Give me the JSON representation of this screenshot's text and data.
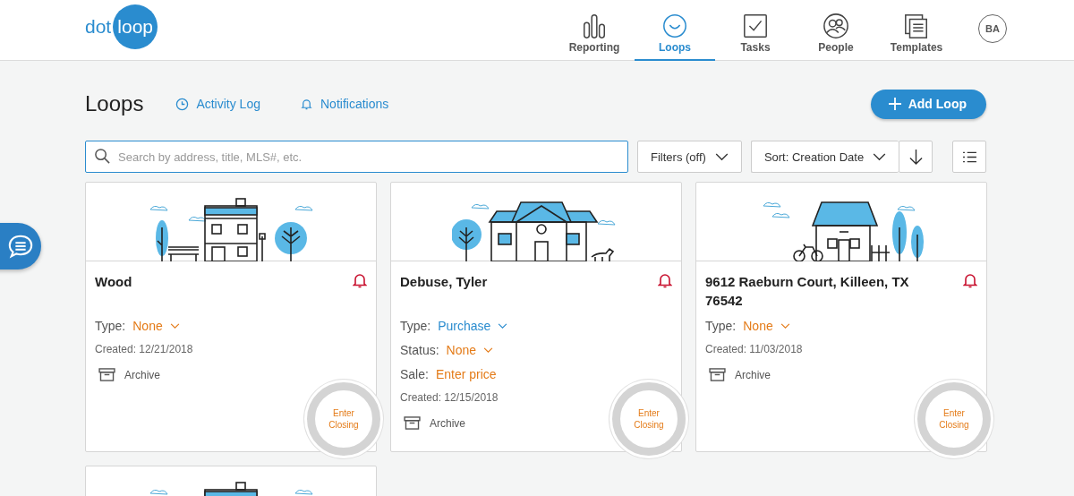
{
  "logo": {
    "left": "dot",
    "right": "loop"
  },
  "nav": [
    {
      "label": "Reporting",
      "selected": false
    },
    {
      "label": "Loops",
      "selected": true
    },
    {
      "label": "Tasks",
      "selected": false
    },
    {
      "label": "People",
      "selected": false
    },
    {
      "label": "Templates",
      "selected": false
    }
  ],
  "avatar": "BA",
  "page_title": "Loops",
  "links": [
    {
      "label": "Activity Log"
    },
    {
      "label": "Notifications"
    }
  ],
  "add_button": "Add Loop",
  "search": {
    "placeholder": "Search by address, title, MLS#, etc."
  },
  "filters": "Filters (off)",
  "sort": "Sort: Creation Date",
  "cards": [
    {
      "kind": "full",
      "title": "Wood",
      "fields": [
        {
          "label": "Type:",
          "value": "None",
          "kind": "dropdown",
          "empty": true
        }
      ],
      "created": "Created: 12/21/2018",
      "archive": "Archive",
      "closing": "Enter Closing"
    },
    {
      "kind": "full",
      "title": "Debuse, Tyler",
      "fields": [
        {
          "label": "Type:",
          "value": "Purchase",
          "kind": "dropdown",
          "empty": false
        },
        {
          "label": "Status:",
          "value": "None",
          "kind": "dropdown",
          "empty": true
        },
        {
          "label": "Sale:",
          "value": "Enter price",
          "kind": "text",
          "empty": true
        }
      ],
      "created": "Created: 12/15/2018",
      "archive": "Archive",
      "closing": "Enter Closing"
    },
    {
      "kind": "full",
      "title": "9612 Raeburn Court, Killeen, TX 76542",
      "fields": [
        {
          "label": "Type:",
          "value": "None",
          "kind": "dropdown",
          "empty": true
        }
      ],
      "created": "Created: 11/03/2018",
      "archive": "Archive",
      "closing": "Enter Closing"
    },
    {
      "kind": "partial"
    }
  ]
}
